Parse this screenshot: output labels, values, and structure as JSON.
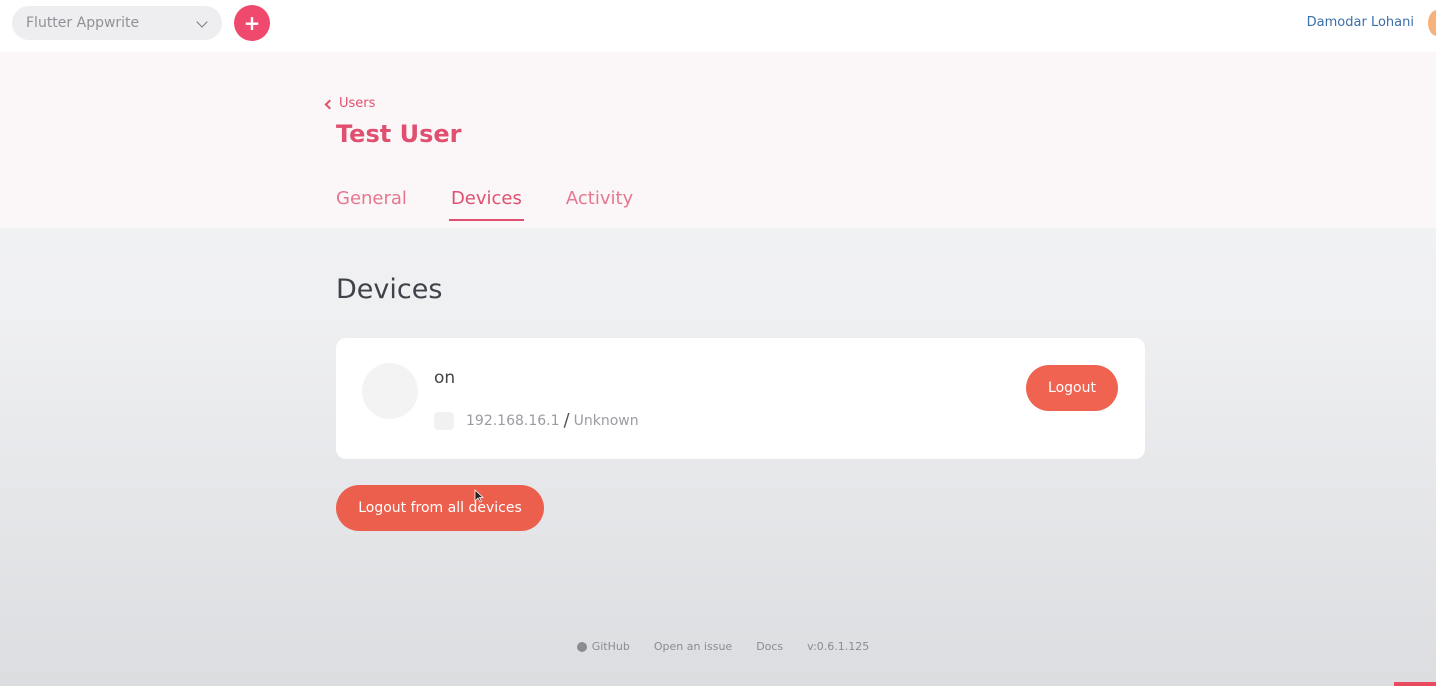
{
  "topbar": {
    "project_name": "Flutter Appwrite",
    "add_label": "+",
    "user_name": "Damodar Lohani"
  },
  "header": {
    "breadcrumb": "Users",
    "title": "Test User",
    "tabs": [
      {
        "label": "General",
        "active": false
      },
      {
        "label": "Devices",
        "active": true
      },
      {
        "label": "Activity",
        "active": false
      }
    ]
  },
  "devices": {
    "section_title": "Devices",
    "items": [
      {
        "name": "on",
        "ip": "192.168.16.1",
        "separator": "/",
        "location": "Unknown",
        "logout_label": "Logout"
      }
    ],
    "logout_all_label": "Logout from all devices"
  },
  "footer": {
    "github": "GitHub",
    "issue": "Open an issue",
    "docs": "Docs",
    "version": "v:0.6.1.125"
  },
  "colors": {
    "accent": "#e04f6f",
    "button": "#ec5f4d"
  }
}
